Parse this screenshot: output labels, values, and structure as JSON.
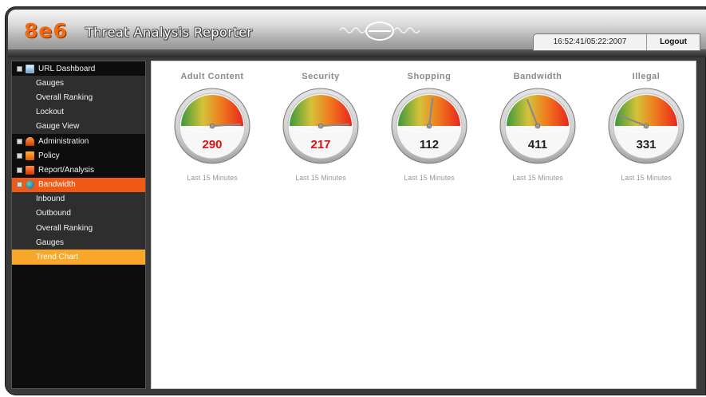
{
  "header": {
    "logo": "8e6",
    "app_title": "Threat Analysis Reporter",
    "timestamp": "16:52:41/05:22:2007",
    "logout_label": "Logout"
  },
  "sidebar": {
    "items": [
      {
        "label": "URL Dashboard",
        "icon": "url-dashboard-icon"
      },
      {
        "label": "Gauges"
      },
      {
        "label": "Overall Ranking"
      },
      {
        "label": "Lockout"
      },
      {
        "label": "Gauge View"
      },
      {
        "label": "Administration",
        "icon": "administration-icon"
      },
      {
        "label": "Policy",
        "icon": "policy-icon"
      },
      {
        "label": "Report/Analysis",
        "icon": "report-analysis-icon"
      },
      {
        "label": "Bandwidth",
        "icon": "bandwidth-icon"
      },
      {
        "label": "Inbound"
      },
      {
        "label": "Outbound"
      },
      {
        "label": "Overall Ranking"
      },
      {
        "label": "Gauges"
      },
      {
        "label": "Trend Chart"
      }
    ]
  },
  "gauges": [
    {
      "title": "Adult Content",
      "value": "290",
      "level": 0.98,
      "red": true,
      "footer": "Last 15 Minutes"
    },
    {
      "title": "Security",
      "value": "217",
      "level": 0.98,
      "red": true,
      "footer": "Last 15 Minutes"
    },
    {
      "title": "Shopping",
      "value": "112",
      "level": 0.54,
      "red": false,
      "footer": "Last 15 Minutes"
    },
    {
      "title": "Bandwidth",
      "value": "411",
      "level": 0.38,
      "red": false,
      "footer": "Last 15 Minutes"
    },
    {
      "title": "Illegal",
      "value": "331",
      "level": 0.12,
      "red": false,
      "footer": "Last 15 Minutes"
    }
  ],
  "colors": {
    "brand_orange": "#f26a10",
    "active_item": "#f05a14",
    "selected_item": "#f8a72a",
    "alert_red": "#e01010"
  }
}
